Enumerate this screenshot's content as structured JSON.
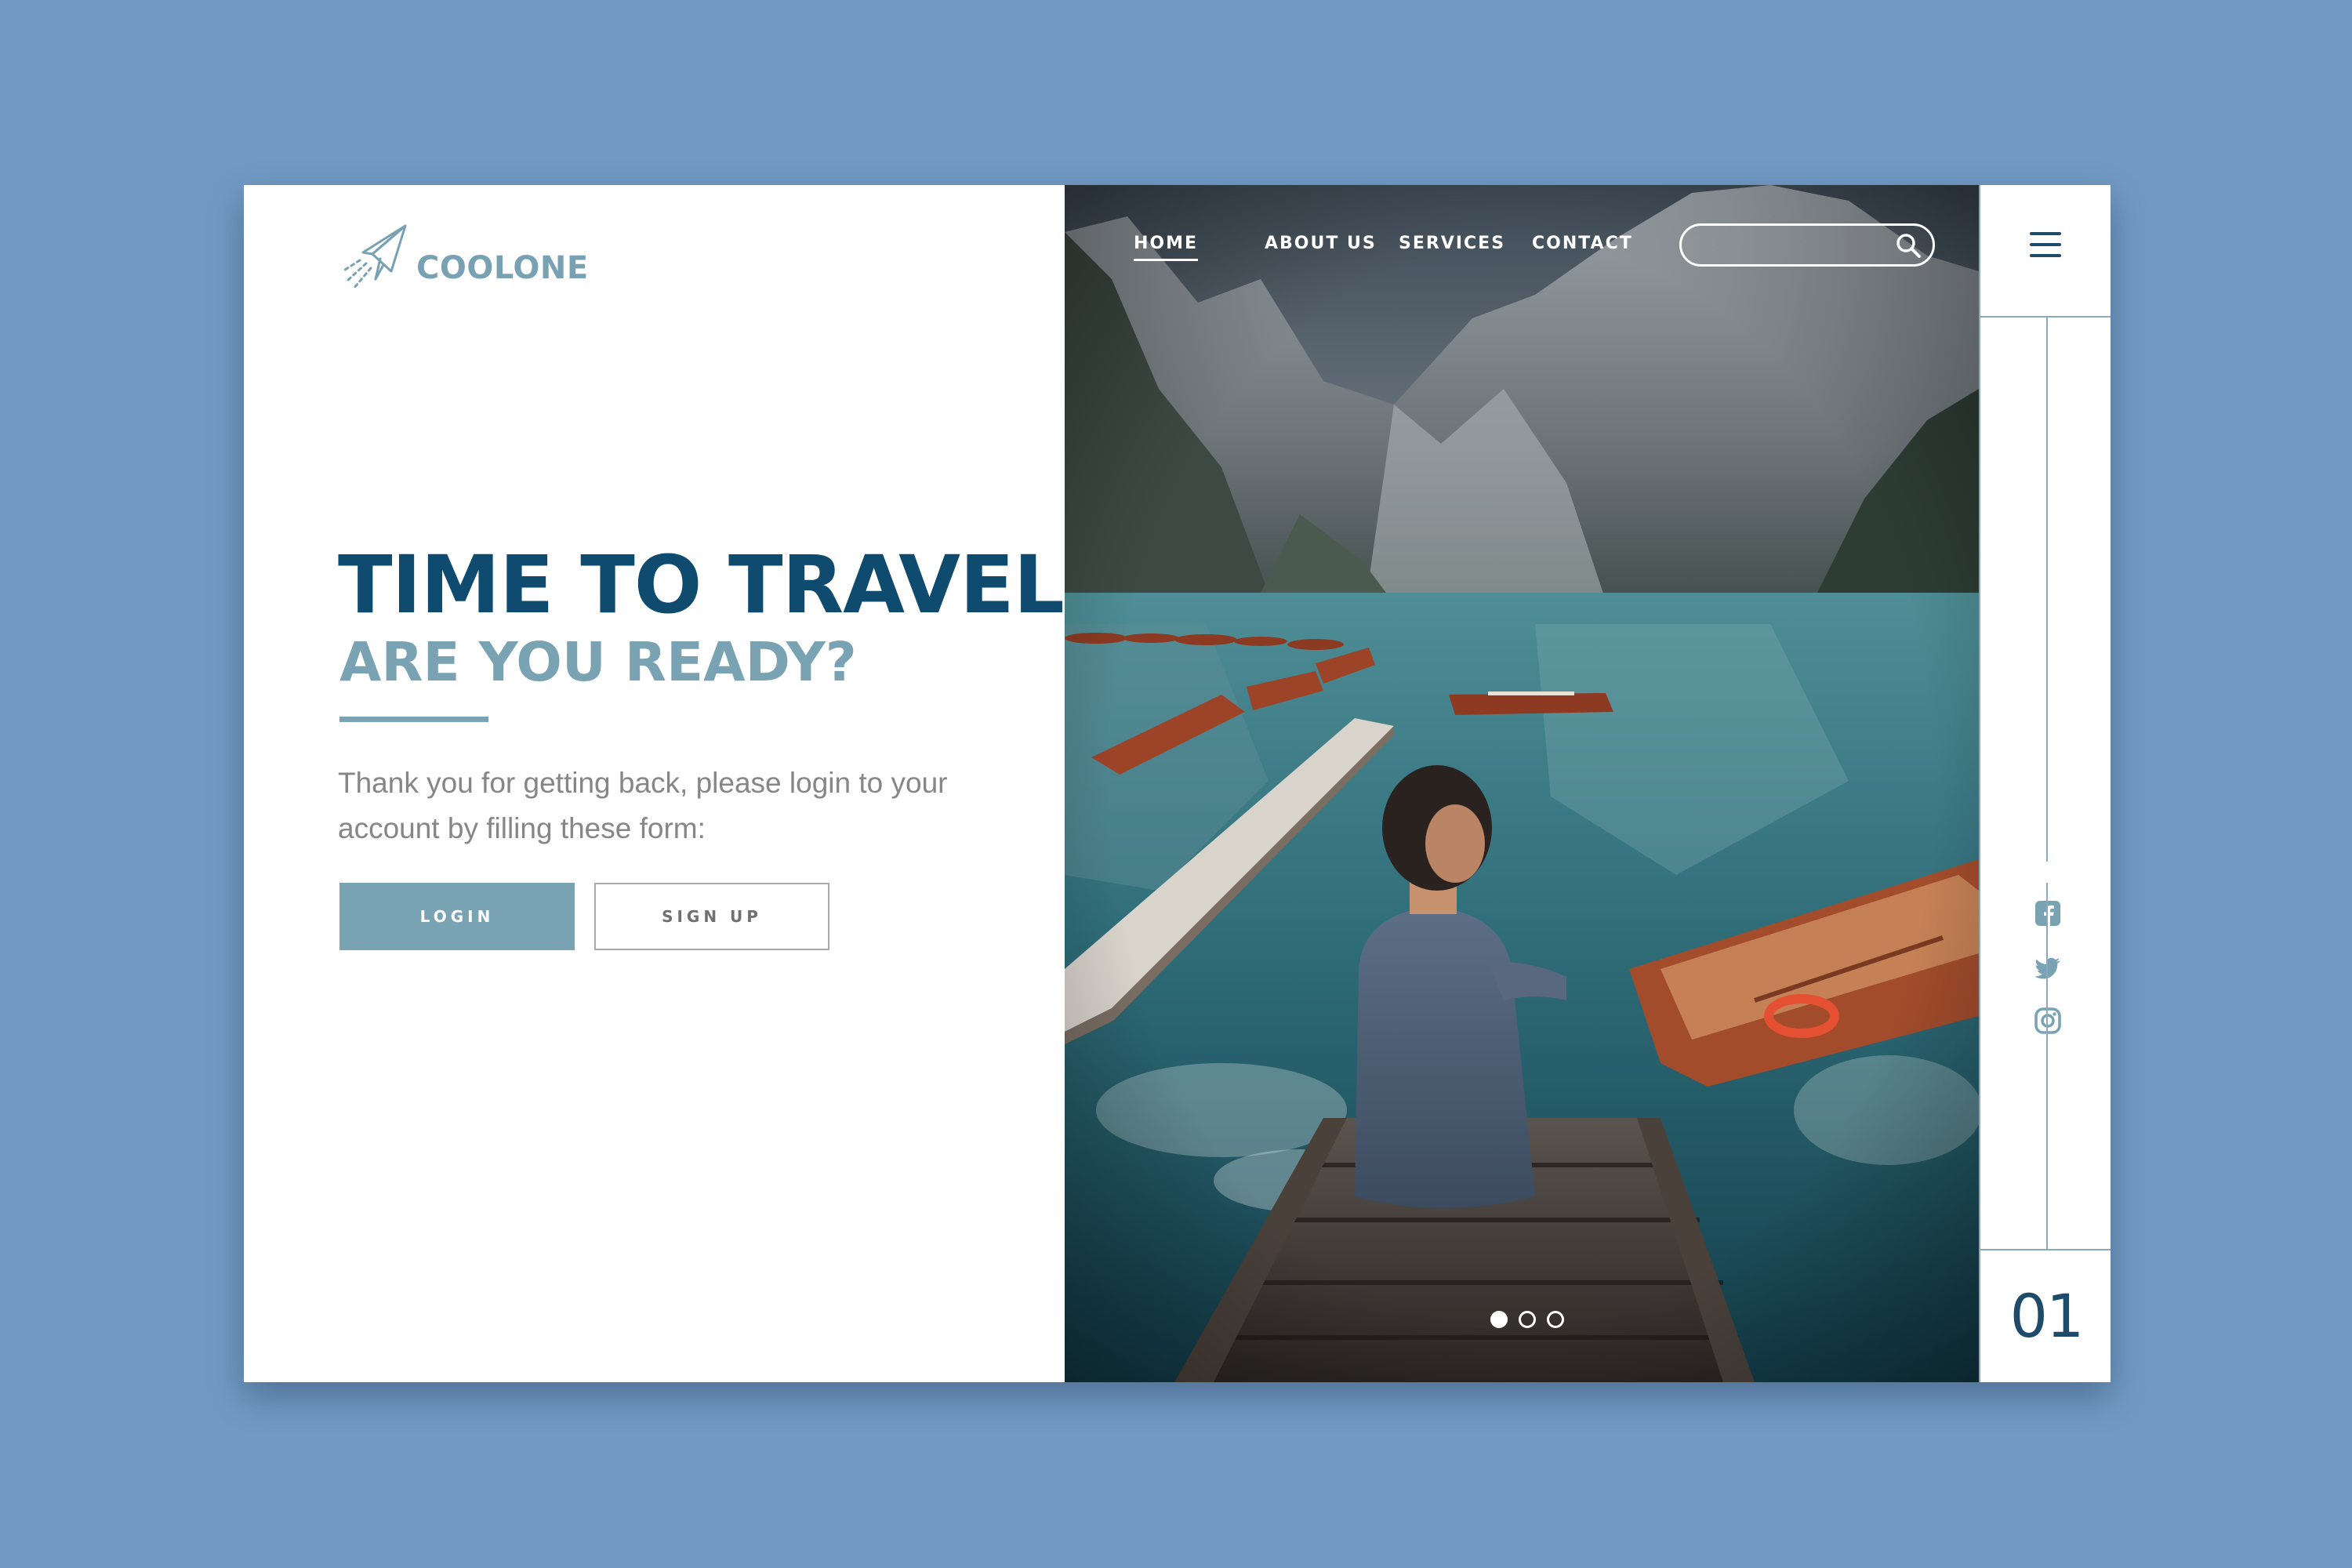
{
  "brand": {
    "name": "COOLONE",
    "logo_icon": "paper-plane-icon",
    "color": "#78a2b3"
  },
  "hero": {
    "title": "TIME TO TRAVEL",
    "subtitle": "ARE YOU READY?",
    "description": "Thank you for getting back, please login to your account by filling these form:",
    "login_label": "LOGIN",
    "signup_label": "SIGN UP"
  },
  "nav": {
    "items": [
      {
        "label": "HOME",
        "active": true
      },
      {
        "label": "ABOUT US",
        "active": false
      },
      {
        "label": "SERVICES",
        "active": false
      },
      {
        "label": "CONTACT",
        "active": false
      }
    ],
    "search": {
      "placeholder": "",
      "value": "",
      "icon": "search-icon"
    }
  },
  "slider": {
    "total": 3,
    "active_index": 0
  },
  "rail": {
    "menu_icon": "hamburger-menu-icon",
    "social": [
      "facebook-icon",
      "twitter-icon",
      "instagram-icon"
    ],
    "page_number": "01"
  },
  "colors": {
    "background": "#7199c3",
    "headline": "#0e4b6e",
    "accent": "#79a3b3",
    "text_muted": "#868686",
    "rail_dark": "#1e4b6a"
  }
}
